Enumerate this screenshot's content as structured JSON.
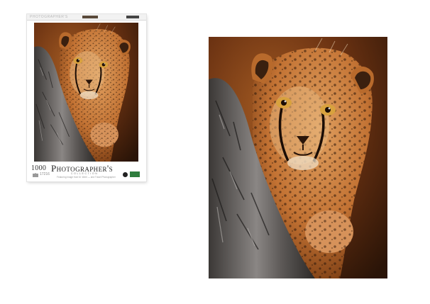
{
  "box": {
    "piece_count": "1000",
    "brand": "Photographer's",
    "collection": "COLLECTION",
    "code": "17216",
    "credit": "Featuring image from M. Wohl — and Travel Photographer",
    "spine_text": "PHOTOGRAPHER'S"
  },
  "colors": {
    "background": "#ffffff",
    "fur": "#c77a36",
    "bark": "#6e6a68",
    "backdrop": "#7a3c15"
  }
}
